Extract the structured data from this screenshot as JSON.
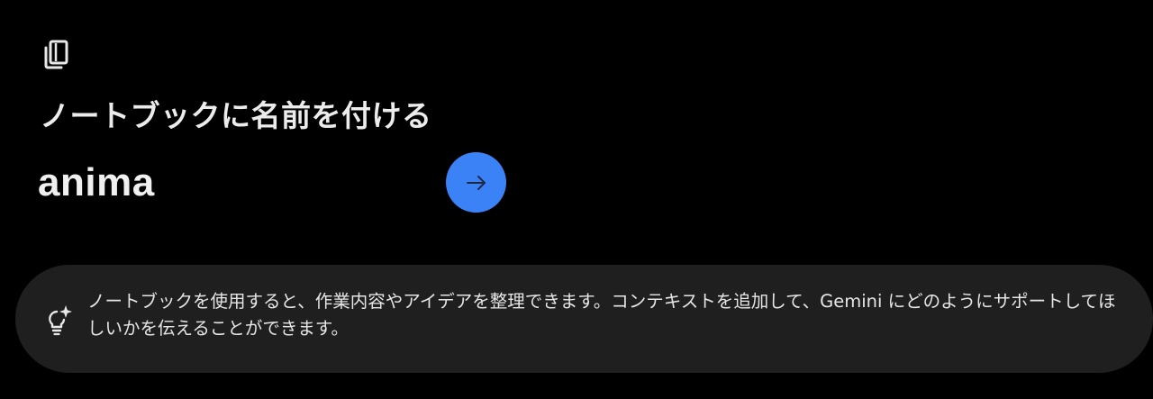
{
  "icons": {
    "notebook": "notebook-copy-icon",
    "submit": "arrow-right-icon",
    "hint": "lightbulb-sparkle-icon"
  },
  "dialog": {
    "title": "ノートブックに名前を付ける",
    "name_value": "anima"
  },
  "hint": {
    "text": "ノートブックを使用すると、作業内容やアイデアを整理できます。コンテキストを追加して、Gemini にどのようにサポートしてほしいかを伝えることができます。"
  },
  "colors": {
    "background": "#000000",
    "accent": "#3b82f6",
    "card": "#1f1f1f",
    "text": "#e8e8e8"
  }
}
